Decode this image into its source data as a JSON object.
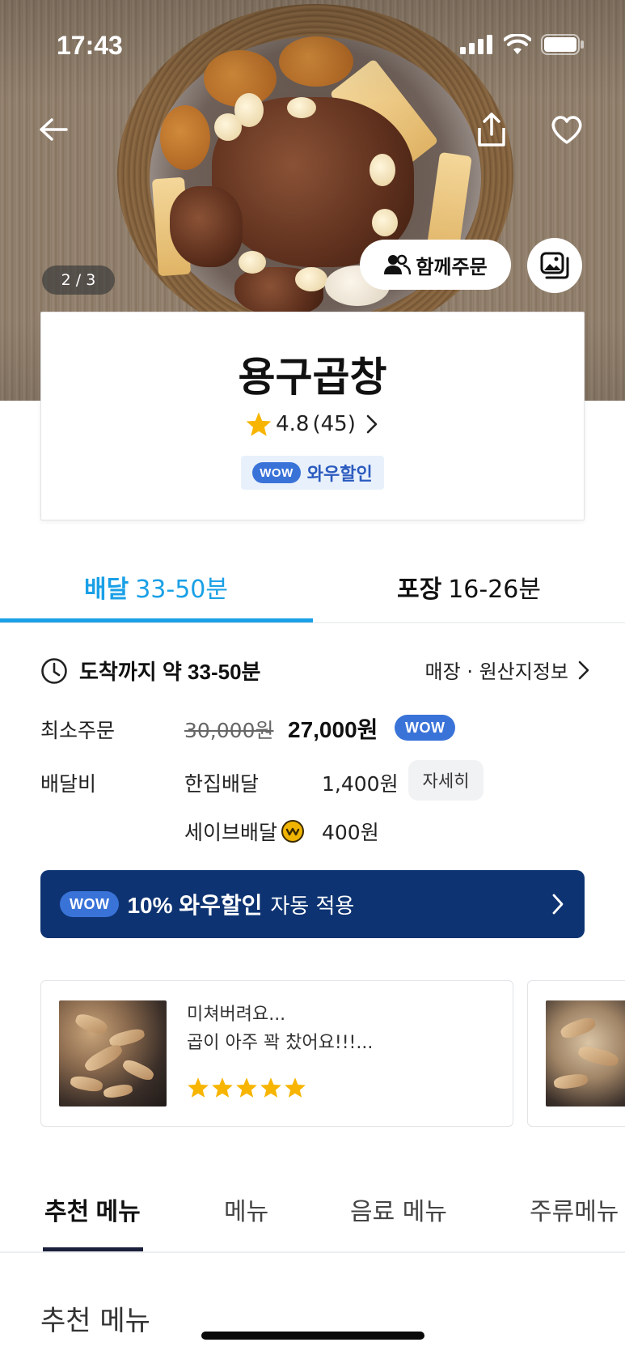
{
  "status_bar": {
    "time": "17:43"
  },
  "hero": {
    "image_counter": "2 / 3",
    "together_order_label": "함께주문"
  },
  "store": {
    "name": "용구곱창",
    "rating": "4.8",
    "review_count": "(45)",
    "wow_badge": "WOW",
    "wow_discount_label": "와우할인"
  },
  "delivery_tabs": [
    {
      "label": "배달",
      "time": "33-50분",
      "active": true
    },
    {
      "label": "포장",
      "time": "16-26분",
      "active": false
    }
  ],
  "delivery_info": {
    "arrival_label": "도착까지 약 33-50분",
    "store_origin_link": "매장 · 원산지정보",
    "min_order_label": "최소주문",
    "min_order_original": "30,000원",
    "min_order_price": "27,000원",
    "min_order_wow": "WOW",
    "delivery_fee_label": "배달비",
    "fee_options": [
      {
        "type": "한집배달",
        "amount": "1,400원"
      },
      {
        "type": "세이브배달",
        "amount": "400원"
      }
    ],
    "detail_button": "자세히"
  },
  "wow_banner": {
    "badge": "WOW",
    "highlight": "10% 와우할인",
    "text": "자동 적용"
  },
  "reviews": [
    {
      "line1": "미쳐버려요...",
      "line2": "곱이 아주 꽉 찼어요!!!...",
      "stars": 5
    }
  ],
  "menu_tabs": [
    {
      "label": "추천 메뉴",
      "active": true
    },
    {
      "label": "메뉴",
      "active": false
    },
    {
      "label": "음료 메뉴",
      "active": false
    },
    {
      "label": "주류메뉴",
      "active": false
    }
  ],
  "section_title": "추천 메뉴",
  "colors": {
    "accent_blue": "#1aa0e6",
    "wow_blue": "#3a73d8",
    "banner_navy": "#0d3372",
    "star_yellow": "#f7b500"
  }
}
